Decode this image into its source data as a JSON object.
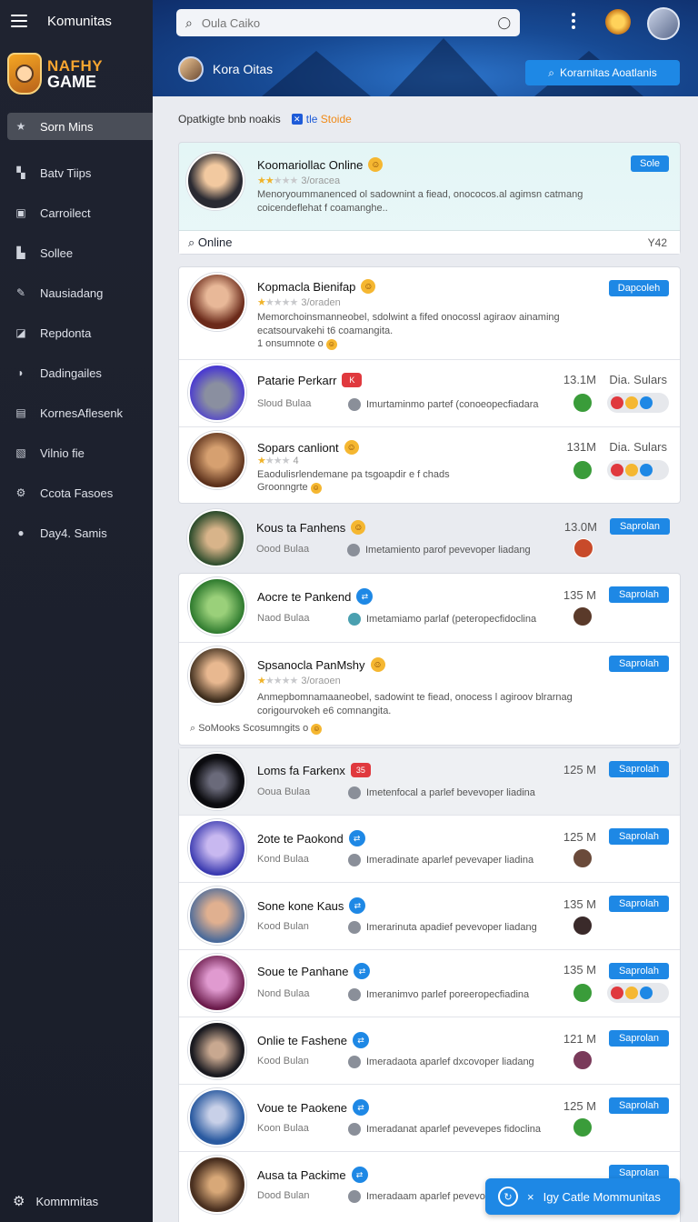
{
  "sidebar": {
    "title": "Komunitas",
    "logo": {
      "line1": "NAFHY",
      "line2": "GAME"
    },
    "items": [
      {
        "label": "Sorn Mins",
        "icon": "star-icon"
      },
      {
        "label": "Batv Tiips",
        "icon": "bookmark-icon"
      },
      {
        "label": "Carroilect",
        "icon": "folder-icon"
      },
      {
        "label": "Sollee",
        "icon": "chart-icon"
      },
      {
        "label": "Nausiadang",
        "icon": "pen-icon"
      },
      {
        "label": "Repdonta",
        "icon": "image-icon"
      },
      {
        "label": "Dadingailes",
        "icon": "tag-icon"
      },
      {
        "label": "KornesAflesenk",
        "icon": "gift-icon"
      },
      {
        "label": "Vilnio fie",
        "icon": "video-icon"
      },
      {
        "label": "Ccota Fasoes",
        "icon": "gear-icon"
      },
      {
        "label": "Day4. Samis",
        "icon": "circle-icon"
      }
    ],
    "bottom_label": "Kommmitas"
  },
  "header": {
    "search_placeholder": "Oula Caiko",
    "profile_name": "Kora Oitas",
    "action_button": "Korarnitas Aoatlanis"
  },
  "filter": {
    "label": "Opatkigte bnb noakis",
    "check1": "tle",
    "check2": "Stoide"
  },
  "featured": {
    "title": "Koomariollac Online",
    "rating_text": "3/oracea",
    "desc": "Menoryoummanenced ol sadownint a fiead, onococos.al agimsn catmang coicendeflehat f coamanghe..",
    "button": "Sole",
    "footer_left": "Online",
    "footer_right": "Y42"
  },
  "group1": {
    "row1": {
      "title": "Kopmacla Bienifap",
      "rating_text": "3/oraden",
      "desc": "Memorchoinsmanneobel, sdolwint a fifed onocossl agiraov ainaming ecatsourvakehi t6 coamangita.",
      "sub": "1 onsumnote o",
      "button": "Dapcoleh"
    },
    "row2": {
      "title": "Patarie Perkarr",
      "badge": "K",
      "sub": "Sloud Bulaa",
      "mid": "Imurtaminmo partef (conoeopecfiadara",
      "count": "13.1M",
      "stat": "Dia. Sulars"
    },
    "row3": {
      "title": "Sopars canliont",
      "rating_text": "4",
      "desc": "Eaodulisrlendemane pa tsgoapdir e f chads",
      "sub": "Groonngrte",
      "count": "131M",
      "stat": "Dia. Sulars"
    }
  },
  "row_solo": {
    "title": "Kous ta Fanhens",
    "sub": "Oood Bulaa",
    "mid": "Imetamiento parof pevevoper liadang",
    "count": "13.0M",
    "button": "Saprolan"
  },
  "group2": {
    "row1": {
      "title": "Aocre te Pankend",
      "sub": "Naod Bulaa",
      "mid": "Imetamiamo parlaf (peteropecfidoclina",
      "count": "135 M",
      "button": "Saprolah"
    },
    "row2": {
      "title": "Spsanocla PanMshy",
      "rating_text": "3/oraoen",
      "desc": "Anmepbomnamaaneobel, sadowint te fiead, onocess l agiroov blrarnag corigourvokeh e6 comnangita.",
      "sub": "SoMooks Scosumngits o",
      "button": "Saprolah"
    }
  },
  "list": [
    {
      "title": "Loms fa Farkenx",
      "badge": "35",
      "badge_type": "red",
      "sub": "Ooua Bulaa",
      "mid": "Imetenfocal a parlef bevevoper liadina",
      "count": "125 M",
      "button": "Saprolah"
    },
    {
      "title": "2ote te Paokond",
      "badge": "⇄",
      "badge_type": "blue",
      "sub": "Kond Bulaa",
      "mid": "Imeradinate aparlef pevevaper liadina",
      "count": "125 M",
      "button": "Saprolah"
    },
    {
      "title": "Sone kone Kaus",
      "badge": "⇄",
      "badge_type": "blue",
      "sub": "Kood Bulan",
      "mid": "Imerarinuta apadief pevevoper liadang",
      "count": "135 M",
      "button": "Saprolah"
    },
    {
      "title": "Soue te Panhane",
      "badge": "⇄",
      "badge_type": "blue",
      "sub": "Nond Bulaa",
      "mid": "Imeranimvo parlef poreeropecfiadina",
      "count": "135 M",
      "button": "Saprolah"
    },
    {
      "title": "Onlie te Fashene",
      "badge": "⇄",
      "badge_type": "blue",
      "sub": "Kood Bulan",
      "mid": "Imeradaota aparlef dxcovoper liadang",
      "count": "121 M",
      "button": "Saprolan"
    },
    {
      "title": "Voue te Paokene",
      "badge": "⇄",
      "badge_type": "blue",
      "sub": "Koon Bulaa",
      "mid": "Imeradanat aparlef pevevepes fidoclina",
      "count": "125 M",
      "button": "Saprolah"
    },
    {
      "title": "Ausa ta Packime",
      "badge": "⇄",
      "badge_type": "blue",
      "sub": "Dood Bulan",
      "mid": "Imeradaam aparlef pevevoper uoro",
      "count": "",
      "button": "Saprolan"
    }
  ],
  "fab": {
    "label": "Igy Catle Mommunitas",
    "prefix": "×"
  },
  "colors": {
    "accent": "#1e88e5",
    "sidebar_bg": "#1f2330",
    "header_bg": "#174a94"
  }
}
